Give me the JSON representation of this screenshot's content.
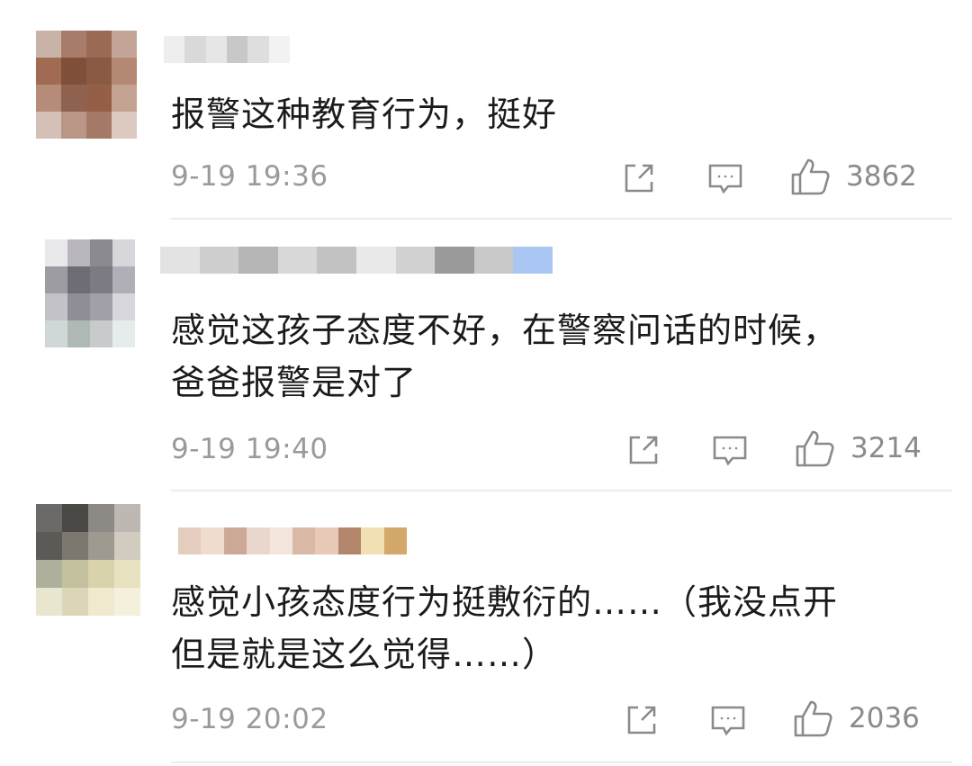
{
  "comments": [
    {
      "text": "报警这种教育行为，挺好",
      "time": "9-19 19:36",
      "likes": "3862",
      "avatar": [
        "#c9b2a8",
        "#a87c69",
        "#9b6a55",
        "#c3a597",
        "#a06b52",
        "#7f4f39",
        "#8b5a44",
        "#b48872",
        "#b58c7a",
        "#8f624f",
        "#955f47",
        "#c4a292",
        "#d4c0b6",
        "#b99685",
        "#a47a66",
        "#dcc9bf"
      ],
      "name": [
        "#eeeeee",
        "#d9d9d9",
        "#e6e6e6",
        "#c8c8c8",
        "#dedede",
        "#f2f2f2"
      ]
    },
    {
      "text": "感觉这孩子态度不好，在警察问话的时候，\n爸爸报警是对了",
      "time": "9-19 19:40",
      "likes": "3214",
      "avatar": [
        "#e9e9ec",
        "#b9b7bd",
        "#8b8a90",
        "#d7d6db",
        "#9d9ca3",
        "#6e6c74",
        "#7c7a82",
        "#b0aeb6",
        "#c4c2c9",
        "#8f8d96",
        "#a19fa7",
        "#d9d7de",
        "#cfd8d6",
        "#aeb9b6",
        "#c7cbcc",
        "#e6eceb"
      ],
      "name": [
        "#e3e3e3",
        "#cfcfcf",
        "#b5b5b5",
        "#d8d8d8",
        "#c2c2c2",
        "#e9e9e9",
        "#d1d1d1",
        "#9a9a9a",
        "#c9c9c9",
        "#a9c7f2"
      ]
    },
    {
      "text": "感觉小孩态度行为挺敷衍的……（我没点开\n但是就是这么觉得……）",
      "time": "9-19 20:02",
      "likes": "2036",
      "avatar": [
        "#6b6a68",
        "#4a4946",
        "#8d8a85",
        "#bdb9b2",
        "#5c5a56",
        "#7c786f",
        "#9e9a8f",
        "#d1ccbf",
        "#aeb09c",
        "#c4c19f",
        "#d8d3ab",
        "#e7e2c0",
        "#e9e6cf",
        "#dcd6b8",
        "#efe9cd",
        "#f4f0dc"
      ],
      "name": [
        "#e4cdbf",
        "#f0dbcf",
        "#cba996",
        "#ead7cc",
        "#f5e6dd",
        "#d9b8a5",
        "#e8c9b8",
        "#b3866b",
        "#f2dfb3",
        "#d4a868"
      ]
    }
  ],
  "icons": {
    "share": "share-icon",
    "reply": "comment-icon",
    "like": "thumbs-up-icon"
  }
}
